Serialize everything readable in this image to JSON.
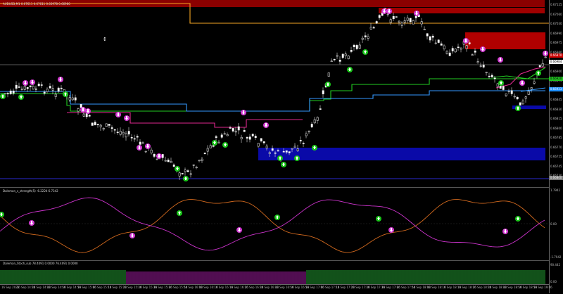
{
  "main": {
    "title": "AUDUSD,M1  0.67611 0.67611 0.66978 0.66980",
    "price_labels": [
      "0.67125",
      "0.67060",
      "0.67030",
      "0.66990",
      "0.66975",
      "0.66960",
      "0.66930",
      "0.66900",
      "0.66875",
      "0.66860",
      "0.66845",
      "0.66830",
      "0.66815",
      "0.66800",
      "0.66785",
      "0.66770",
      "0.66755",
      "0.66745",
      "0.66730"
    ],
    "tags": {
      "current": "0.66984",
      "blue": "0.66933",
      "green": "0.66920",
      "red": "0.66870",
      "gray": "0.66840"
    }
  },
  "ind1": {
    "title": "Daleman_c_strength(5) -6.2224 6.7342",
    "scale": [
      "1.7942",
      "0.00",
      "-1.7942"
    ]
  },
  "ind2": {
    "title": "Daleman_Stoch_sub 78.4091 0.0000 76.4091 0.0000",
    "scale": [
      "90.442",
      "0.00"
    ]
  },
  "time_labels": [
    "16 Sep 2022",
    "16 Sep 14:34",
    "16 Sep 14:42",
    "16 Sep 14:50",
    "16 Sep 14:58",
    "16 Sep 15:06",
    "16 Sep 15:14",
    "16 Sep 15:22",
    "16 Sep 15:30",
    "16 Sep 15:38",
    "16 Sep 15:46",
    "16 Sep 15:54",
    "16 Sep 16:02",
    "16 Sep 16:10",
    "16 Sep 16:18",
    "16 Sep 16:26",
    "16 Sep 16:34",
    "16 Sep 16:42",
    "16 Sep 16:50",
    "16 Sep 16:58",
    "16 Sep 17:06",
    "16 Sep 17:14",
    "16 Sep 17:22",
    "16 Sep 17:30",
    "16 Sep 17:38",
    "16 Sep 17:46",
    "16 Sep 17:54",
    "16 Sep 18:02",
    "16 Sep 18:10",
    "16 Sep 18:18",
    "16 Sep 18:26",
    "16 Sep 18:34",
    "16 Sep 18:42",
    "16 Sep 18:50",
    "16 Sep 18:58",
    "16 Sep 19:06"
  ],
  "colors": {
    "bull": "#ffffff",
    "bear": "#ffffff",
    "support": "#1e1eb4",
    "resistance": "#8b0000",
    "orange": "#f5a623",
    "green": "#22cc22",
    "blue": "#3399ff",
    "magenta": "#e0298f",
    "ind_orange": "#d2691e",
    "ind_magenta": "#cc33cc",
    "hist_green": "#2ecc40",
    "hist_magenta": "#cc22cc"
  },
  "icons": {
    "up": "up-arrow-icon",
    "down": "down-arrow-icon"
  }
}
